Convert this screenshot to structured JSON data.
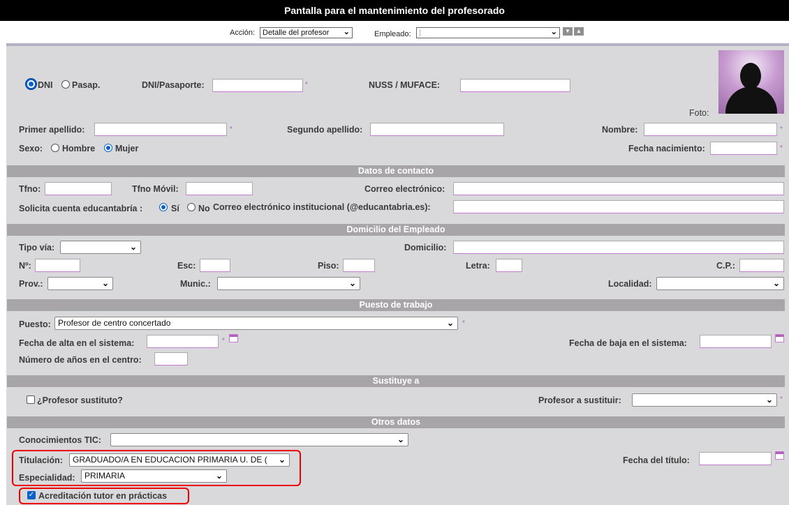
{
  "header": {
    "title": "Pantalla para el mantenimiento del profesorado"
  },
  "toolbar": {
    "accion_label": "Acción:",
    "accion_value": "Detalle del profesor",
    "empleado_label": "Empleado:",
    "empleado_value": "|"
  },
  "identity": {
    "dni_label": "DNI",
    "pasap_label": "Pasap.",
    "doc_type_selected": "DNI",
    "dni_pasaporte_label": "DNI/Pasaporte:",
    "nuss_label": "NUSS / MUFACE:",
    "foto_label": "Foto:",
    "primer_apellido_label": "Primer apellido:",
    "segundo_apellido_label": "Segundo apellido:",
    "nombre_label": "Nombre:",
    "sexo_label": "Sexo:",
    "hombre_label": "Hombre",
    "mujer_label": "Mujer",
    "sexo_selected": "Mujer",
    "fecha_nacimiento_label": "Fecha nacimiento:",
    "required_mark": "*"
  },
  "contacto": {
    "section_title": "Datos de contacto",
    "tfno_label": "Tfno:",
    "movil_label": "Tfno Móvil:",
    "correo_label": "Correo electrónico:",
    "solicita_label": "Solicita cuenta educantabría :",
    "si_label": "Sí",
    "no_label": "No",
    "solicita_selected": "Sí",
    "correo_institucional_label": "Correo electrónico institucional (@educantabria.es):"
  },
  "domicilio": {
    "section_title": "Domicilio del Empleado",
    "tipo_via_label": "Tipo vía:",
    "domicilio_label": "Domicilio:",
    "num_label": "Nº:",
    "esc_label": "Esc:",
    "piso_label": "Piso:",
    "letra_label": "Letra:",
    "cp_label": "C.P.:",
    "prov_label": "Prov.:",
    "munic_label": "Munic.:",
    "localidad_label": "Localidad:"
  },
  "puesto": {
    "section_title": "Puesto de trabajo",
    "puesto_label": "Puesto:",
    "puesto_value": "Profesor de centro concertado",
    "fecha_alta_label": "Fecha de alta en el sistema:",
    "fecha_baja_label": "Fecha de baja en el sistema:",
    "anios_label": "Número de años en el centro:"
  },
  "sustituye": {
    "section_title": "Sustituye a",
    "sustituto_label": "¿Profesor sustituto?",
    "sustituto_checked": false,
    "profesor_sustituir_label": "Profesor a sustituir:"
  },
  "otros": {
    "section_title": "Otros datos",
    "tic_label": "Conocimientos TIC:",
    "titulacion_label": "Titulación:",
    "titulacion_value": "GRADUADO/A EN EDUCACION PRIMARIA U. DE (",
    "fecha_titulo_label": "Fecha del título:",
    "especialidad_label": "Especialidad:",
    "especialidad_value": "PRIMARIA",
    "acreditacion_label": "Acreditación tutor en prácticas",
    "acreditacion_checked": true
  },
  "icons": {
    "dropdown": "chevron-down-icon",
    "calendar": "calendar-icon",
    "move_down": "triangle-down-icon",
    "move_up": "triangle-up-icon"
  }
}
